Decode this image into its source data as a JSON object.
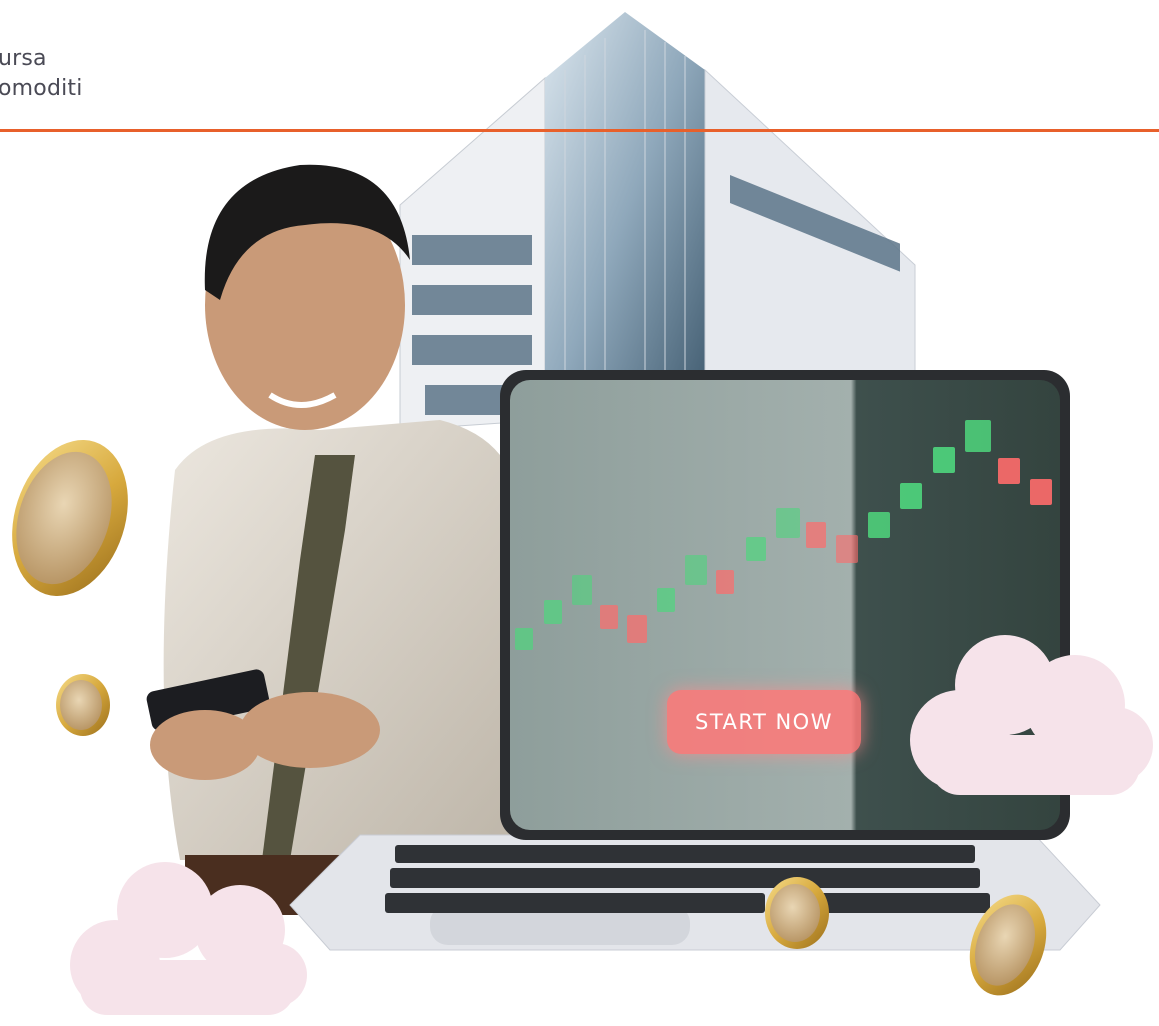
{
  "brand": {
    "line1": "ursa",
    "line2": "omoditi",
    "accent_color": "#e8602b"
  },
  "hero": {
    "cta_label": "START NOW",
    "cta_color": "#ff7878",
    "candle_up_color": "#4fd67d",
    "candle_down_color": "#ff6b6b"
  }
}
